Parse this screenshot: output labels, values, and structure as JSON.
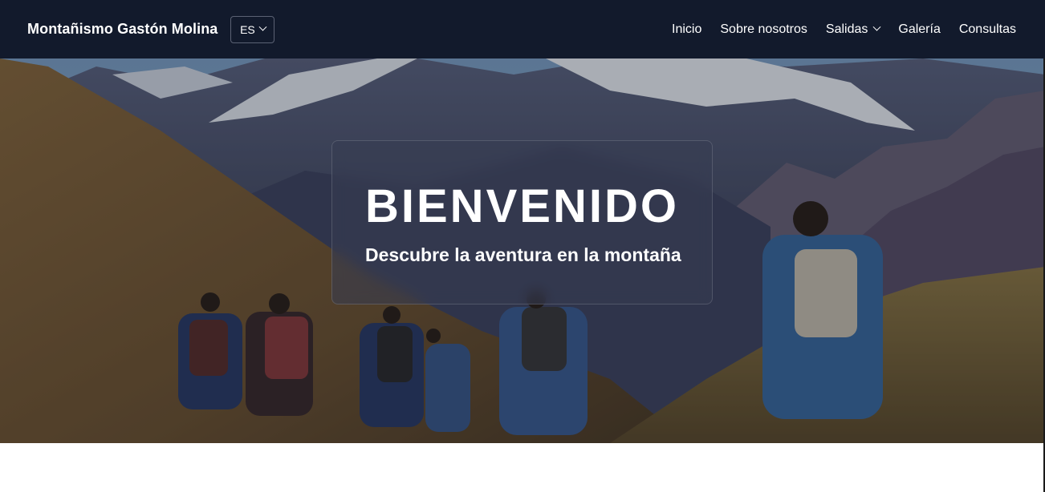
{
  "header": {
    "brand": "Montañismo Gastón Molina",
    "language": "ES",
    "nav": [
      {
        "label": "Inicio"
      },
      {
        "label": "Sobre nosotros"
      },
      {
        "label": "Salidas"
      },
      {
        "label": "Galería"
      },
      {
        "label": "Consultas"
      }
    ]
  },
  "hero": {
    "title": "BIENVENIDO",
    "subtitle": "Descubre la aventura en la montaña",
    "image": "mountain-hikers-photo"
  },
  "colors": {
    "navbar": "#121a2c",
    "text": "#ffffff"
  }
}
